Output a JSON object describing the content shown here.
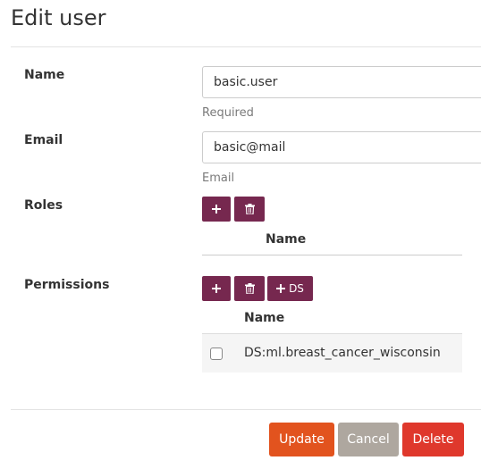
{
  "page": {
    "title": "Edit user"
  },
  "form": {
    "name": {
      "label": "Name",
      "value": "basic.user",
      "help": "Required"
    },
    "email": {
      "label": "Email",
      "value": "basic@mail",
      "help": "Email"
    },
    "roles": {
      "label": "Roles",
      "column_header": "Name"
    },
    "permissions": {
      "label": "Permissions",
      "column_header": "Name",
      "add_ds_label": "DS",
      "rows": [
        {
          "name": "DS:ml.breast_cancer_wisconsin",
          "checked": false
        }
      ]
    }
  },
  "actions": {
    "update_label": "Update",
    "cancel_label": "Cancel",
    "delete_label": "Delete"
  },
  "colors": {
    "primary": "#76284f",
    "update": "#e2531e",
    "cancel": "#aea79f",
    "delete": "#df382c"
  }
}
